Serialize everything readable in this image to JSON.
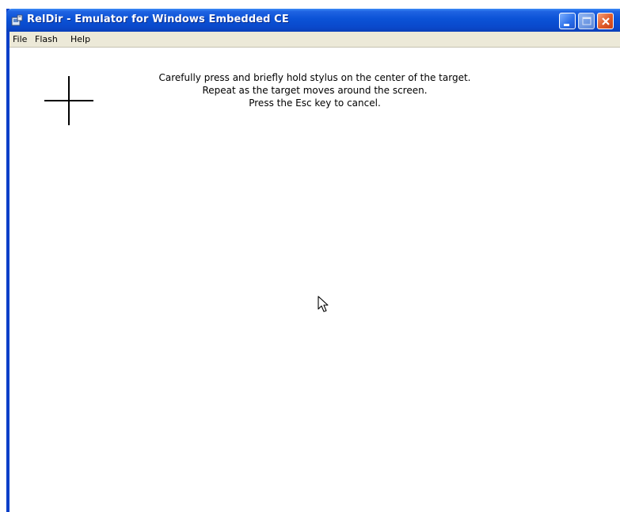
{
  "window": {
    "title": "RelDir - Emulator for Windows Embedded CE",
    "title_color": "#0b52d6",
    "border_color": "#0a3fc8"
  },
  "menu": {
    "items": [
      {
        "label": "File"
      },
      {
        "label": "Flash"
      },
      {
        "label": "Help"
      }
    ]
  },
  "calibration": {
    "lines": [
      "Carefully press and briefly hold stylus on the center of the target.",
      "Repeat as the target moves around the screen.",
      "Press the Esc key to cancel."
    ],
    "target_icon": "crosshair-target-icon"
  },
  "cursor_icon": "mouse-pointer-icon"
}
